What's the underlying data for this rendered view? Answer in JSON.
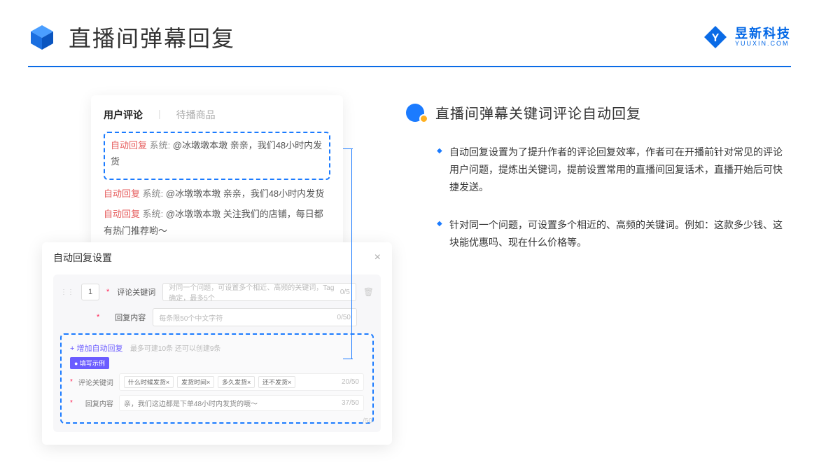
{
  "header": {
    "title": "直播间弹幕回复",
    "logo_cn": "昱新科技",
    "logo_en": "YUUXIN.COM"
  },
  "comments": {
    "tab_active": "用户评论",
    "tab_inactive": "待播商品",
    "row1_tag": "自动回复",
    "row1_sys": "系统:",
    "row1_text": "@冰墩墩本墩 亲亲，我们48小时内发货",
    "row2_tag": "自动回复",
    "row2_sys": "系统:",
    "row2_text": "@冰墩墩本墩 亲亲，我们48小时内发货",
    "row3_tag": "自动回复",
    "row3_sys": "系统:",
    "row3_text": "@冰墩墩本墩 关注我们的店铺，每日都有热门推荐哟～"
  },
  "settings": {
    "title": "自动回复设置",
    "num": "1",
    "label_keyword": "评论关键词",
    "placeholder_keyword": "对同一个问题，可设置多个相近、高频的关键词，Tag确定，最多5个",
    "count_keyword": "0/5",
    "label_content": "回复内容",
    "placeholder_content": "每条限50个中文字符",
    "count_content": "0/50",
    "add_link": "+ 增加自动回复",
    "add_hint": "最多可建10条 还可以创建9条",
    "example_badge": "● 填写示例",
    "ex_label_keyword": "评论关键词",
    "ex_tags": [
      "什么时候发货×",
      "发货时间×",
      "多久发货×",
      "还不发货×"
    ],
    "ex_count_keyword": "20/50",
    "ex_label_content": "回复内容",
    "ex_content": "亲，我们这边都是下单48小时内发货的哦～",
    "ex_count_content": "37/50",
    "extra_count": "/50"
  },
  "right": {
    "section_title": "直播间弹幕关键词评论自动回复",
    "bullet1": "自动回复设置为了提升作者的评论回复效率，作者可在开播前针对常见的评论用户问题，提炼出关键词，提前设置常用的直播间回复话术，直播开始后可快捷发送。",
    "bullet2": "针对同一个问题，可设置多个相近的、高频的关键词。例如：这款多少钱、这块能优惠吗、现在什么价格等。"
  }
}
